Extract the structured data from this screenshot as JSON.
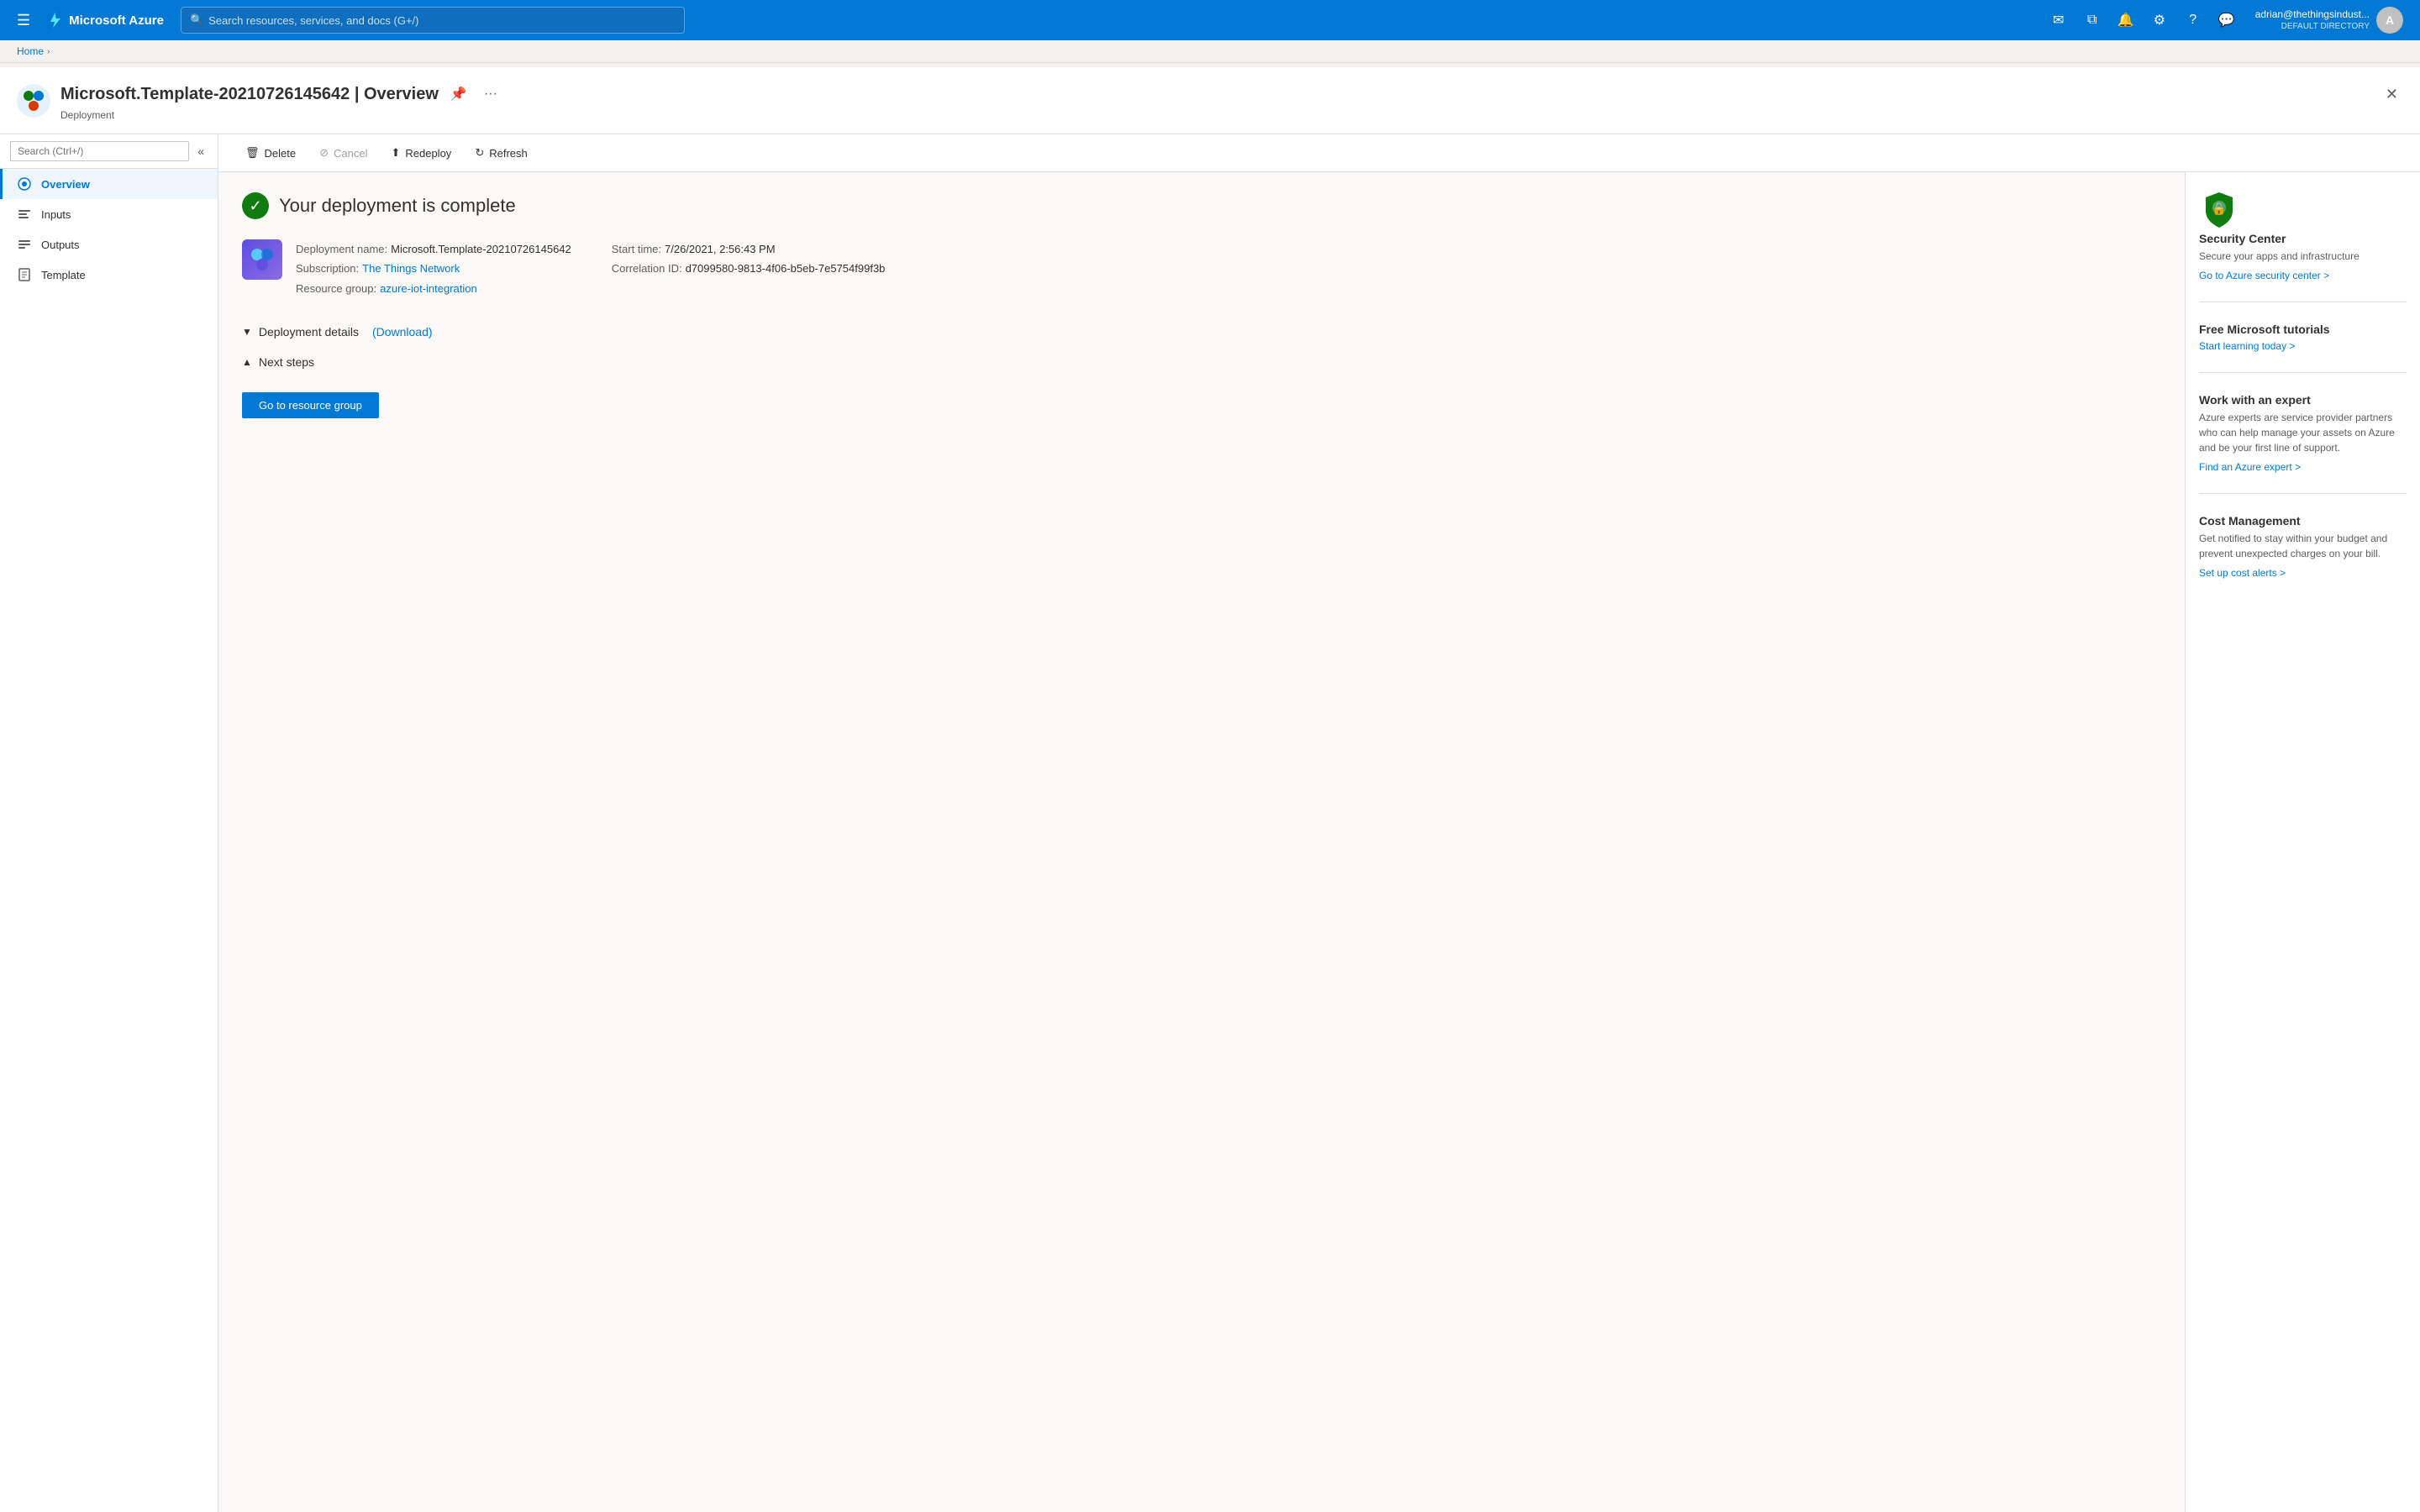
{
  "topNav": {
    "brand": "Microsoft Azure",
    "searchPlaceholder": "Search resources, services, and docs (G+/)",
    "user": {
      "name": "adrian@thethingsindust...",
      "directory": "DEFAULT DIRECTORY",
      "initials": "A"
    },
    "icons": [
      "✉",
      "📋",
      "🔔",
      "⚙",
      "?",
      "👥"
    ]
  },
  "breadcrumb": {
    "items": [
      "Home"
    ]
  },
  "pageHeader": {
    "title": "Microsoft.Template-20210726145642 | Overview",
    "subtitle": "Deployment"
  },
  "toolbar": {
    "delete_label": "Delete",
    "cancel_label": "Cancel",
    "redeploy_label": "Redeploy",
    "refresh_label": "Refresh"
  },
  "sidebar": {
    "searchPlaceholder": "Search (Ctrl+/)",
    "navItems": [
      {
        "label": "Overview",
        "icon": "🏠",
        "active": true
      },
      {
        "label": "Inputs",
        "icon": "📥",
        "active": false
      },
      {
        "label": "Outputs",
        "icon": "📤",
        "active": false
      },
      {
        "label": "Template",
        "icon": "📄",
        "active": false
      }
    ]
  },
  "main": {
    "deploymentComplete": {
      "title": "Your deployment is complete"
    },
    "deploymentInfo": {
      "name": "Microsoft.Template-20210726145642",
      "subscription": "The Things Network",
      "resourceGroup": "azure-iot-integration",
      "startTime": "7/26/2021, 2:56:43 PM",
      "correlationId": "d7099580-9813-4f06-b5eb-7e5754f99f3b"
    },
    "deploymentDetails": {
      "label": "Deployment details",
      "downloadLabel": "(Download)",
      "collapsed": true
    },
    "nextSteps": {
      "label": "Next steps",
      "expanded": true,
      "goToResourceGroupBtn": "Go to resource group"
    }
  },
  "rightPanel": {
    "sections": [
      {
        "id": "security-center",
        "title": "Security Center",
        "desc": "Secure your apps and infrastructure",
        "linkText": "Go to Azure security center >",
        "hasIcon": true
      },
      {
        "id": "free-tutorials",
        "title": "Free Microsoft tutorials",
        "desc": "",
        "linkText": "Start learning today >"
      },
      {
        "id": "work-expert",
        "title": "Work with an expert",
        "desc": "Azure experts are service provider partners who can help manage your assets on Azure and be your first line of support.",
        "linkText": "Find an Azure expert >"
      },
      {
        "id": "cost-management",
        "title": "Cost Management",
        "desc": "Get notified to stay within your budget and prevent unexpected charges on your bill.",
        "linkText": "Set up cost alerts >"
      }
    ]
  }
}
